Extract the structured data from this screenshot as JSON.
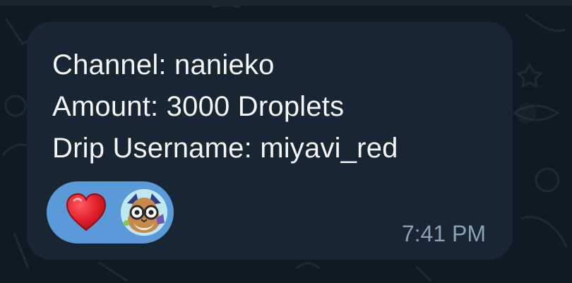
{
  "message": {
    "lines": {
      "channel": "Channel: nanieko",
      "amount": "Amount: 3000 Droplets",
      "username": "Drip Username: miyavi_red"
    },
    "time": "7:41 PM"
  },
  "reactions": [
    {
      "type": "heart",
      "icon": "heart-icon"
    },
    {
      "type": "avatar",
      "icon": "user-avatar"
    }
  ],
  "colors": {
    "background": "#0f1a24",
    "bubble": "#182533",
    "reaction_pill": "#5a9ad8",
    "text": "#f5f5f5",
    "timestamp": "#8aa1b6",
    "heart": "#e5222d"
  }
}
